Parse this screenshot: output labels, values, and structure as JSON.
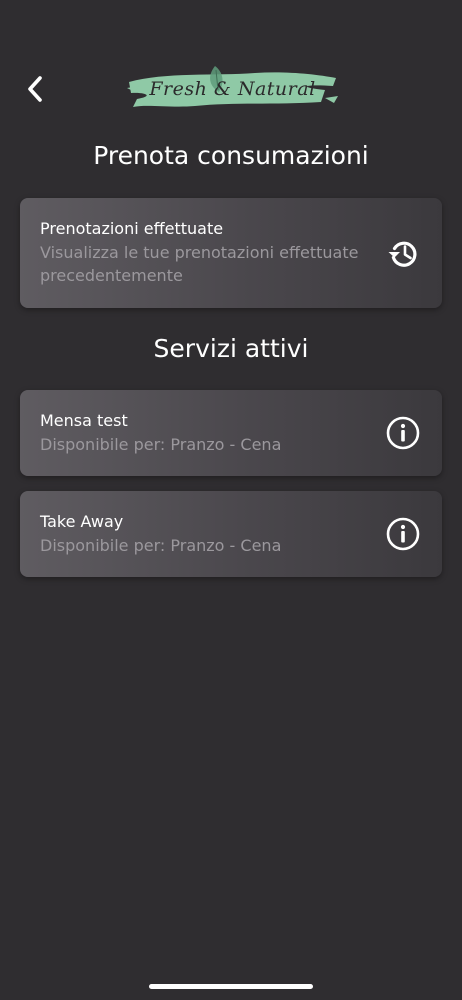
{
  "header": {
    "logo_text": "Fresh & Natural",
    "back_icon": "chevron-left-icon"
  },
  "page": {
    "title": "Prenota consumazioni",
    "services_title": "Servizi attivi"
  },
  "history_card": {
    "title": "Prenotazioni effettuate",
    "subtitle": "Visualizza le tue prenotazioni effettuate precedentemente",
    "icon": "history-icon"
  },
  "services": [
    {
      "title": "Mensa test",
      "subtitle": "Disponibile per: Pranzo - Cena",
      "icon": "info-icon"
    },
    {
      "title": "Take Away",
      "subtitle": "Disponibile per: Pranzo - Cena",
      "icon": "info-icon"
    }
  ],
  "colors": {
    "background": "#2f2d30",
    "card_start": "#5f5c61",
    "card_end": "#3b393d",
    "subtitle": "#9b989d",
    "logo_brush": "#8fc9a6"
  }
}
